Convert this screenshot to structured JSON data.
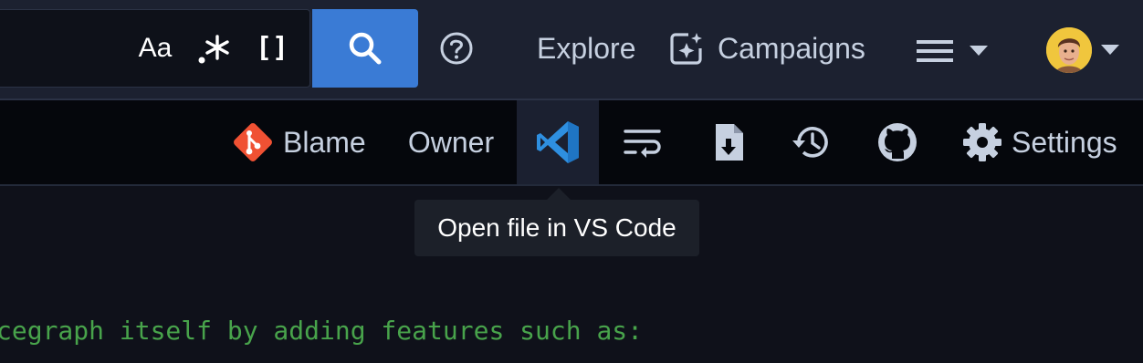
{
  "search": {
    "placeholder": "",
    "options": {
      "case": "Aa",
      "regex": ".*",
      "structural": "[]"
    },
    "button_icon": "search-icon"
  },
  "nav": {
    "help_icon": "question-circle-icon",
    "explore": "Explore",
    "campaigns": "Campaigns",
    "campaigns_icon": "campaigns-sparkle-icon",
    "menu_icon": "hamburger-icon",
    "user_icon": "avatar"
  },
  "actions": {
    "blame": "Blame",
    "owner": "Owner",
    "vscode_icon": "vscode-icon",
    "wrap_icon": "wrap-lines-icon",
    "download_icon": "file-download-icon",
    "history_icon": "history-icon",
    "github_icon": "github-icon",
    "settings": "Settings"
  },
  "tooltip": {
    "text": "Open file in VS Code"
  },
  "code": {
    "line": "cegraph itself by adding features such as:"
  },
  "colors": {
    "accent": "#3a7bd5",
    "git": "#f05133",
    "vscode": "#2e8fe0",
    "code_text": "#48a34b",
    "avatar_bg": "#f0c63d"
  }
}
